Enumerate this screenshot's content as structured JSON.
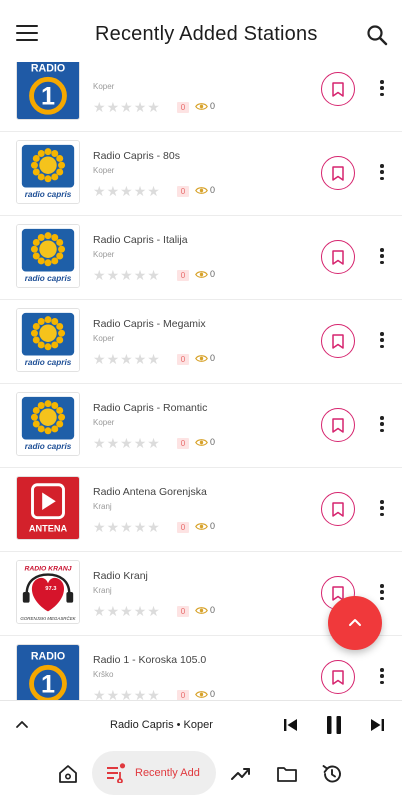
{
  "header": {
    "title": "Recently Added Stations"
  },
  "stations": [
    {
      "name": "",
      "city": "Koper",
      "logo": "radio1",
      "rating_badge": "0",
      "views": "0"
    },
    {
      "name": "Radio Capris - 80s",
      "city": "Koper",
      "logo": "capris",
      "rating_badge": "0",
      "views": "0"
    },
    {
      "name": "Radio Capris - Italija",
      "city": "Koper",
      "logo": "capris",
      "rating_badge": "0",
      "views": "0"
    },
    {
      "name": "Radio Capris - Megamix",
      "city": "Koper",
      "logo": "capris",
      "rating_badge": "0",
      "views": "0"
    },
    {
      "name": "Radio Capris - Romantic",
      "city": "Koper",
      "logo": "capris",
      "rating_badge": "0",
      "views": "0"
    },
    {
      "name": "Radio Antena Gorenjska",
      "city": "Kranj",
      "logo": "antena",
      "rating_badge": "0",
      "views": "0"
    },
    {
      "name": "Radio Kranj",
      "city": "Kranj",
      "logo": "kranj",
      "rating_badge": "0",
      "views": "0"
    },
    {
      "name": "Radio 1 - Koroska 105.0",
      "city": "Krško",
      "logo": "radio1",
      "rating_badge": "0",
      "views": "0"
    }
  ],
  "logo_text": {
    "capris": "radio capris",
    "antena": "ANTENA",
    "radio1_top": "RADIO",
    "radio1_num": "1",
    "kranj_top": "RADIO KRANJ",
    "kranj_freq": "97.3",
    "kranj_bottom": "GORENJSKI MEGASRČEK"
  },
  "player": {
    "now_playing": "Radio Capris • Koper"
  },
  "bottom_nav": {
    "active_label": "Recently Add"
  },
  "icons": {
    "menu": "hamburger-menu-icon",
    "search": "search-icon",
    "bookmark": "bookmark-icon",
    "more": "more-vertical-icon",
    "fab": "chevron-up-icon",
    "views": "eye-icon",
    "home": "home-icon",
    "recent": "playlist-icon",
    "trending": "trending-up-icon",
    "folder": "folder-icon",
    "history": "history-icon"
  },
  "colors": {
    "accent": "#d6246e",
    "fab": "#f0393b",
    "capris_blue": "#1e5fa8",
    "antena_red": "#d3212b",
    "views_eye": "#d7a22a"
  }
}
